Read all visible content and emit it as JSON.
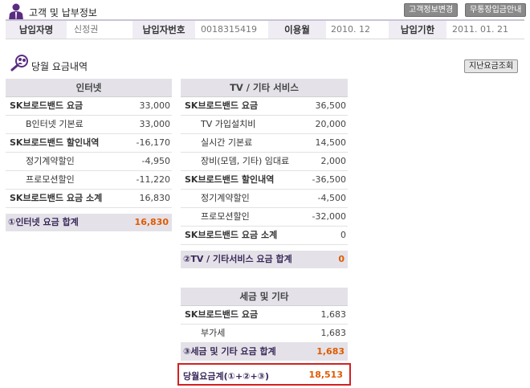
{
  "header": {
    "title": "고객 및 납부정보",
    "buttons": {
      "customer_change": "고객정보변경",
      "bank_guide": "무통장입금안내"
    }
  },
  "info": {
    "payer_name_label": "납입자명",
    "payer_name": "신정권",
    "payer_no_label": "납입자번호",
    "payer_no": "0018315419",
    "usage_month_label": "이용월",
    "usage_month": "2010. 12",
    "due_date_label": "납입기한",
    "due_date": "2011. 01. 21"
  },
  "section": {
    "title": "당월 요금내역",
    "past_button": "지난요금조회"
  },
  "internet": {
    "header": "인터넷",
    "rows": [
      {
        "label": "SK브로드밴드 요금",
        "value": "33,000",
        "kind": "main"
      },
      {
        "label": "B인터넷 기본료",
        "value": "33,000",
        "kind": "sub"
      },
      {
        "label": "SK브로드밴드 할인내역",
        "value": "-16,170",
        "kind": "main"
      },
      {
        "label": "정기계약할인",
        "value": "-4,950",
        "kind": "sub"
      },
      {
        "label": "프로모션할인",
        "value": "-11,220",
        "kind": "sub"
      },
      {
        "label": "SK브로드밴드 요금 소계",
        "value": "16,830",
        "kind": "main"
      }
    ],
    "sum_label": "①인터넷 요금 합계",
    "sum_value": "16,830"
  },
  "tv": {
    "header": "TV / 기타 서비스",
    "rows": [
      {
        "label": "SK브로드밴드 요금",
        "value": "36,500",
        "kind": "main"
      },
      {
        "label": "TV 가입설치비",
        "value": "20,000",
        "kind": "sub"
      },
      {
        "label": "실시간 기본료",
        "value": "14,500",
        "kind": "sub"
      },
      {
        "label": "장비(모뎀, 기타) 임대료",
        "value": "2,000",
        "kind": "sub"
      },
      {
        "label": "SK브로드밴드 할인내역",
        "value": "-36,500",
        "kind": "main"
      },
      {
        "label": "정기계약할인",
        "value": "-4,500",
        "kind": "sub"
      },
      {
        "label": "프로모션할인",
        "value": "-32,000",
        "kind": "sub"
      },
      {
        "label": "SK브로드밴드 요금 소계",
        "value": "0",
        "kind": "main"
      }
    ],
    "sum_label": "②TV / 기타서비스 요금 합계",
    "sum_value": "0"
  },
  "tax": {
    "header": "세금 및 기타",
    "rows": [
      {
        "label": "SK브로드밴드 요금",
        "value": "1,683",
        "kind": "main"
      },
      {
        "label": "부가세",
        "value": "1,683",
        "kind": "sub"
      }
    ],
    "sum_label": "③세금 및 기타 요금 합계",
    "sum_value": "1,683"
  },
  "total": {
    "label": "당월요금계(①+②+③)",
    "value": "18,513"
  }
}
